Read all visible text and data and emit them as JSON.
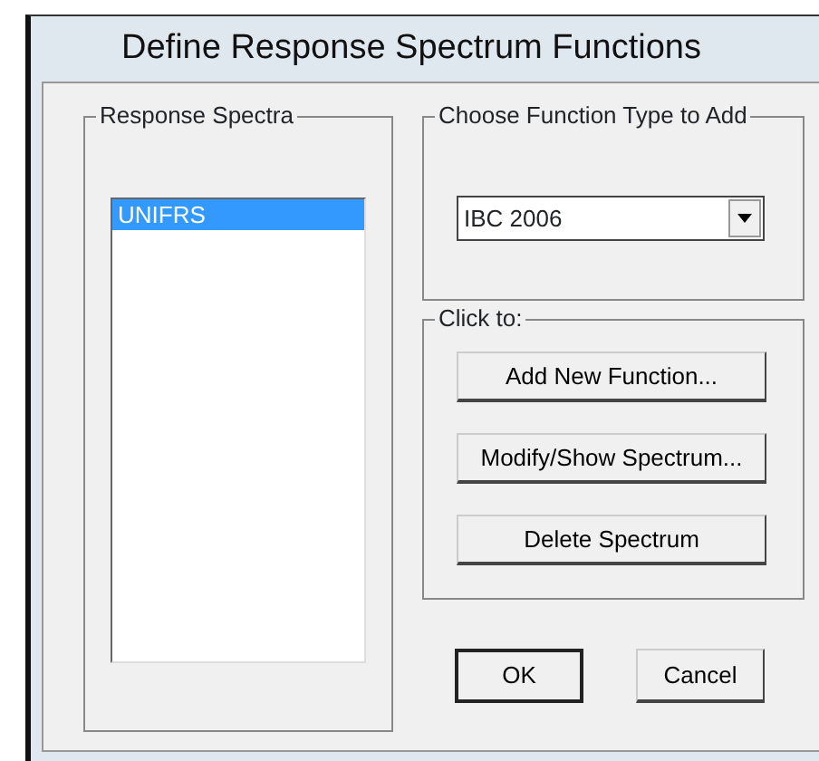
{
  "window": {
    "title": "Define Response Spectrum Functions"
  },
  "response_spectra": {
    "label": "Response Spectra",
    "items": [
      {
        "label": "UNIFRS",
        "selected": true
      }
    ]
  },
  "function_type": {
    "label": "Choose  Function Type to Add",
    "value": "IBC 2006"
  },
  "click_to": {
    "label": "Click to:",
    "buttons": [
      "Add New Function...",
      "Modify/Show Spectrum...",
      "Delete Spectrum"
    ]
  },
  "footer_buttons": [
    {
      "label": "OK",
      "default": true
    },
    {
      "label": "Cancel",
      "default": false
    }
  ]
}
